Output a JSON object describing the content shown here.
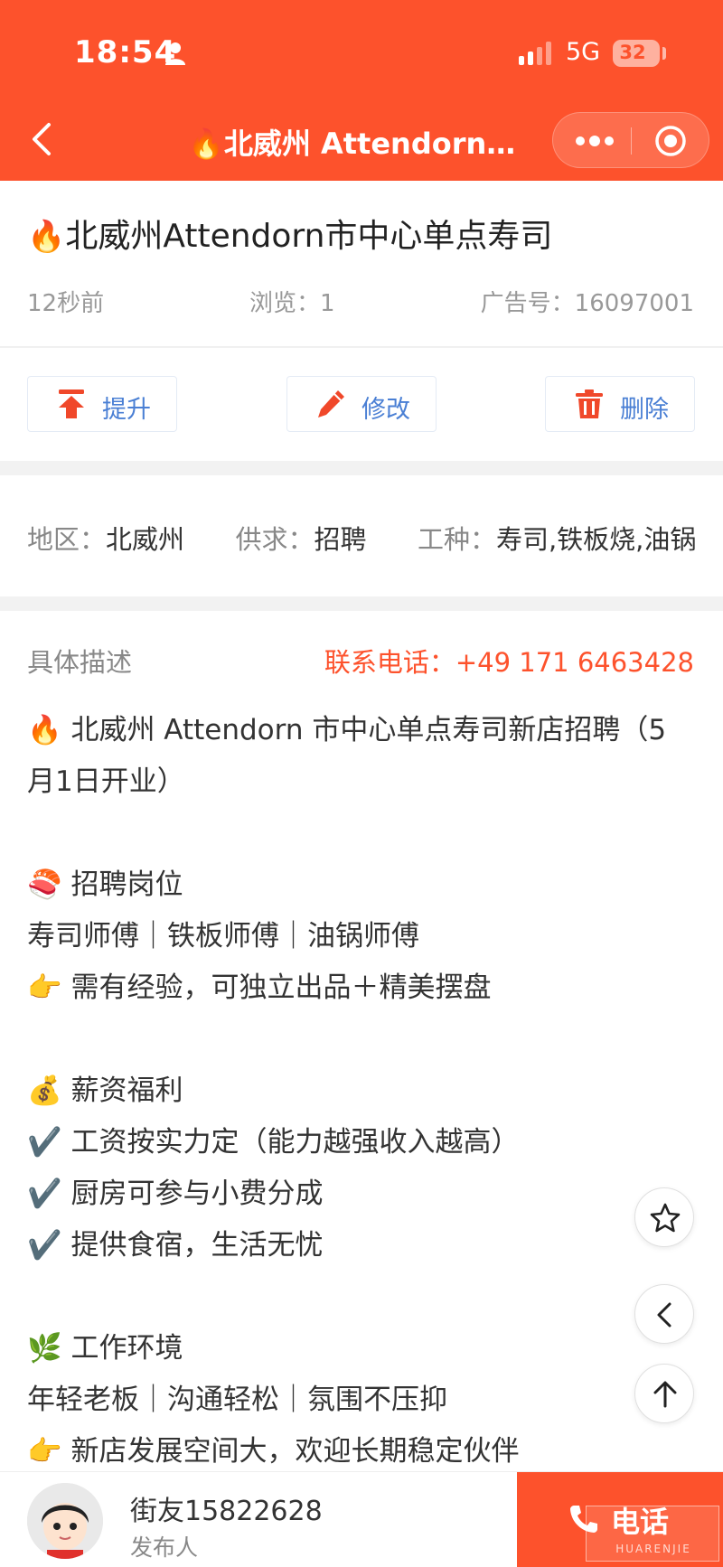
{
  "status_bar": {
    "time": "18:54",
    "network": "5G",
    "battery": "32",
    "battery_fraction": 0.32
  },
  "nav": {
    "title": "🔥北威州 Attendorn市..."
  },
  "post": {
    "title": "北威州Attendorn市中心单点寿司",
    "time_ago": "12秒前",
    "views": "浏览：1",
    "ad_number": "广告号：16097001"
  },
  "actions": [
    {
      "label": "提升",
      "icon": "promote-icon"
    },
    {
      "label": "修改",
      "icon": "pencil-icon"
    },
    {
      "label": "删除",
      "icon": "trash-icon"
    }
  ],
  "info": {
    "region_key": "地区：",
    "region_value": "北威州",
    "type_key": "供求：",
    "type_value": "招聘",
    "job_key": "工种：",
    "job_value": "寿司,铁板烧,油锅"
  },
  "description": {
    "heading": "具体描述",
    "contact": "联系电话：+49 171 6463428",
    "lines": [
      "🔥 北威州 Attendorn 市中心单点寿司新店招聘（5",
      "月1日开业）",
      "",
      "🍣 招聘岗位",
      "寿司师傅｜铁板师傅｜油锅师傅",
      "👉 需有经验，可独立出品＋精美摆盘",
      "",
      "💰 薪资福利",
      "✔️ 工资按实力定（能力越强收入越高）",
      "✔️ 厨房可参与小费分成",
      "✔️ 提供食宿，生活无忧",
      "",
      "🌿 工作环境",
      "年轻老板｜沟通轻松｜氛围不压抑",
      "👉 新店发展空间大，欢迎长期稳定伙伴"
    ]
  },
  "poster": {
    "name": "街友15822628",
    "role": "发布人"
  },
  "call_button": {
    "label": "电话"
  },
  "watermark": {
    "text": "HUARENJIE"
  },
  "colors": {
    "brand": "#fd522c",
    "link_blue": "#4a7fd4"
  }
}
